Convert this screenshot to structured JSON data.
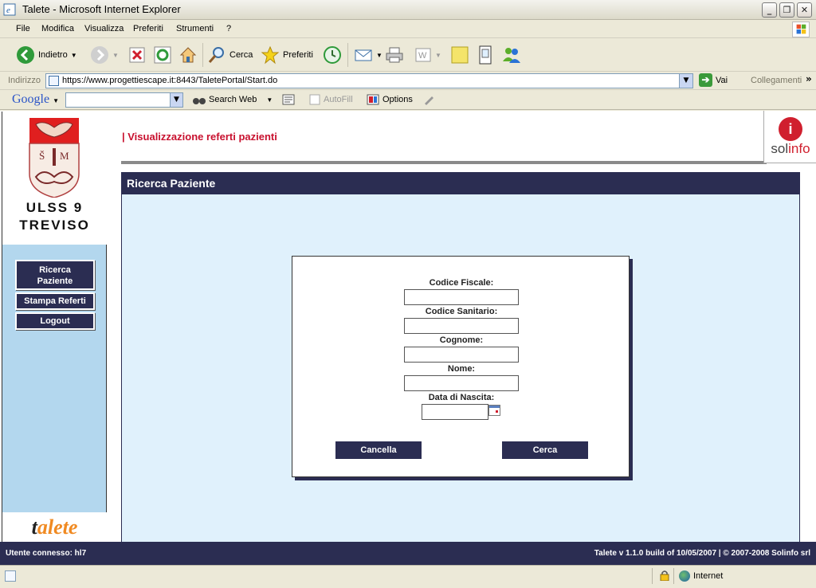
{
  "window": {
    "title": "Talete - Microsoft Internet Explorer",
    "minimize": "_",
    "restore": "❐",
    "close": "✕"
  },
  "menu": {
    "items": [
      "File",
      "Modifica",
      "Visualizza",
      "Preferiti",
      "Strumenti",
      "?"
    ]
  },
  "toolbar": {
    "back_label": "Indietro",
    "search_label": "Cerca",
    "favorites_label": "Preferiti"
  },
  "address": {
    "label": "Indirizzo",
    "url": "https://www.progettiescape.it:8443/TaletePortal/Start.do",
    "go_label": "Vai",
    "links_label": "Collegamenti"
  },
  "google": {
    "logo": "Google",
    "search_web": "Search Web",
    "autofill": "AutoFill",
    "options": "Options"
  },
  "page": {
    "org_line1": "ULSS 9",
    "org_line2": "TREVISO",
    "nav": [
      {
        "label": "Ricerca Paziente"
      },
      {
        "label": "Stampa Referti"
      },
      {
        "label": "Logout"
      }
    ],
    "header_title": "| Visualizzazione referti pazienti",
    "brand_logo": "solinfo",
    "panel_title": "Ricerca Paziente",
    "form": {
      "codice_fiscale_label": "Codice Fiscale:",
      "codice_sanitario_label": "Codice Sanitario:",
      "cognome_label": "Cognome:",
      "nome_label": "Nome:",
      "data_nascita_label": "Data di Nascita:",
      "codice_fiscale_value": "",
      "codice_sanitario_value": "",
      "cognome_value": "",
      "nome_value": "",
      "data_nascita_value": "",
      "cancel_label": "Cancella",
      "search_label": "Cerca"
    },
    "footer_left": "Utente connesso: hl7",
    "footer_right": "Talete v 1.1.0 build of 10/05/2007 | © 2007-2008 Solinfo srl",
    "talete_logo": "talete"
  },
  "status": {
    "zone": "Internet"
  },
  "colors": {
    "navy": "#2b2d52",
    "panel_bg": "#e0f1fc",
    "sidebar_bg": "#b3d7ee",
    "accent_red": "#c8102e",
    "talete_orange": "#f08a22"
  }
}
